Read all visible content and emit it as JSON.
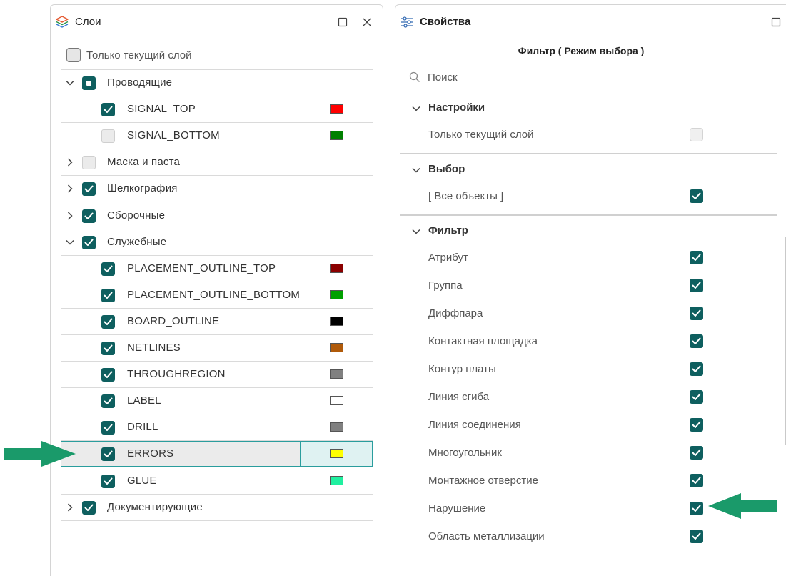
{
  "layers_panel": {
    "title": "Слои",
    "icon": "layers-icon",
    "only_current": {
      "label": "Только текущий слой",
      "checked": false
    },
    "rows": [
      {
        "label": "Проводящие",
        "type": "group",
        "expanded": true,
        "state": "partial"
      },
      {
        "label": "SIGNAL_TOP",
        "type": "layer",
        "state": "checked",
        "color": "#ff0000"
      },
      {
        "label": "SIGNAL_BOTTOM",
        "type": "layer",
        "state": "unchecked",
        "color": "#008000"
      },
      {
        "label": "Маска и паста",
        "type": "group",
        "expanded": false,
        "state": "unchecked"
      },
      {
        "label": "Шелкография",
        "type": "group",
        "expanded": false,
        "state": "checked"
      },
      {
        "label": "Сборочные",
        "type": "group",
        "expanded": false,
        "state": "checked"
      },
      {
        "label": "Служебные",
        "type": "group",
        "expanded": true,
        "state": "checked"
      },
      {
        "label": "PLACEMENT_OUTLINE_TOP",
        "type": "layer",
        "state": "checked",
        "color": "#8b0000"
      },
      {
        "label": "PLACEMENT_OUTLINE_BOTTOM",
        "type": "layer",
        "state": "checked",
        "color": "#00a000"
      },
      {
        "label": "BOARD_OUTLINE",
        "type": "layer",
        "state": "checked",
        "color": "#000000"
      },
      {
        "label": "NETLINES",
        "type": "layer",
        "state": "checked",
        "color": "#b05a0a"
      },
      {
        "label": "THROUGHREGION",
        "type": "layer",
        "state": "checked",
        "color": "#808080"
      },
      {
        "label": "LABEL",
        "type": "layer",
        "state": "checked",
        "color": "#ffffff"
      },
      {
        "label": "DRILL",
        "type": "layer",
        "state": "checked",
        "color": "#808080"
      },
      {
        "label": "ERRORS",
        "type": "layer",
        "state": "checked",
        "color": "#ffff00",
        "selected": true
      },
      {
        "label": "GLUE",
        "type": "layer",
        "state": "checked",
        "color": "#20f0a0"
      },
      {
        "label": "Документирующие",
        "type": "group",
        "expanded": false,
        "state": "checked"
      }
    ]
  },
  "props_panel": {
    "title": "Свойства",
    "icon": "sliders-icon",
    "subtitle": "Фильтр ( Режим выбора )",
    "search_placeholder": "Поиск",
    "sections": [
      {
        "title": "Настройки",
        "items": [
          {
            "label": "Только текущий слой",
            "checked": false
          }
        ]
      },
      {
        "title": "Выбор",
        "items": [
          {
            "label": "[ Все объекты ]",
            "checked": true
          }
        ]
      },
      {
        "title": "Фильтр",
        "items": [
          {
            "label": "Атрибут",
            "checked": true
          },
          {
            "label": "Группа",
            "checked": true
          },
          {
            "label": "Диффпара",
            "checked": true
          },
          {
            "label": "Контактная площадка",
            "checked": true
          },
          {
            "label": "Контур платы",
            "checked": true
          },
          {
            "label": "Линия сгиба",
            "checked": true
          },
          {
            "label": "Линия соединения",
            "checked": true
          },
          {
            "label": "Многоугольник",
            "checked": true
          },
          {
            "label": "Монтажное отверстие",
            "checked": true
          },
          {
            "label": "Нарушение",
            "checked": true
          },
          {
            "label": "Область металлизации",
            "checked": true
          }
        ]
      }
    ]
  },
  "colors": {
    "accent": "#0e5f5f",
    "arrow": "#1a9a6a",
    "selection_bg": "#dff2f2",
    "selection_border": "#2a9d9d"
  }
}
